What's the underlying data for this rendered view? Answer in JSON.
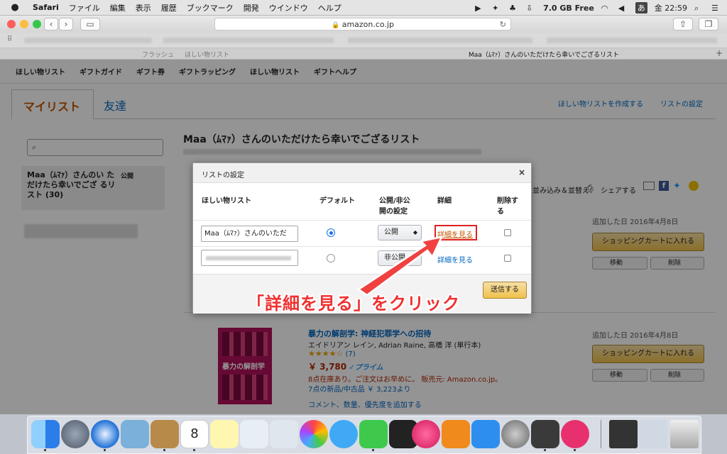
{
  "menubar": {
    "app": "Safari",
    "items": [
      "ファイル",
      "編集",
      "表示",
      "履歴",
      "ブックマーク",
      "開発",
      "ウインドウ",
      "ヘルプ"
    ],
    "memory": "7.0 GB Free",
    "ime": "あ",
    "clock": "金 22:59"
  },
  "browser": {
    "url": "amazon.co.jp",
    "tab_title": "Maa（ﾑﾏｧ）さんのいただけたら幸いでござるリスト",
    "tab_left_text": "フラッシュ",
    "tab_left_text2": "ほしい物リスト"
  },
  "page": {
    "nav": [
      "ほしい物リスト",
      "ギフトガイド",
      "ギフト券",
      "ギフトラッピング",
      "ほしい物リスト",
      "ギフトヘルプ"
    ],
    "tab_mylist": "マイリスト",
    "tab_friends": "友達",
    "link_create": "ほしい物リストを作成する",
    "link_settings": "リストの設定",
    "list_title": "Maa（ﾑﾏｧ）さんのいただけたら幸いでござるリスト",
    "sidebar_list": "Maa（ﾑﾏｧ）さんのい ただけたら幸いでござ るリスト (30)",
    "sidebar_public": "公開",
    "sort_label": "並み込み＆並替え：",
    "share_label": "シェアする",
    "item1": {
      "added": "追加した日 2016年4月8日",
      "cart": "ショッピングカートに入れる",
      "move": "移動",
      "delete": "削除"
    },
    "item2": {
      "added": "追加した日 2016年4月8日",
      "cart": "ショッピングカートに入れる",
      "move": "移動",
      "delete": "削除",
      "title": "暴力の解剖学: 神経犯罪学への招待",
      "author": "エイドリアン レイン, Adrian Raine, 高橋 洋 (単行本)",
      "rating_count": "(7)",
      "price": "￥ 3,780",
      "prime": "✓プライム",
      "stock": "8点在庫あり。ご注文はお早めに。 販売元: Amazon.co.jp。",
      "offers": "7点の新品/中古品 ￥ 3,223より",
      "comment": "コメント、数量、優先度を追加する",
      "cover": "暴力の解剖学",
      "rating": 4.0
    }
  },
  "dialog": {
    "title": "リストの設定",
    "close": "×",
    "col_list": "ほしい物リスト",
    "col_default": "デフォルト",
    "col_public_1": "公開/非公",
    "col_public_2": "開の設定",
    "col_detail": "詳細",
    "col_delete_1": "削除す",
    "col_delete_2": "る",
    "rows": [
      {
        "name": "Maa（ﾑﾏｧ）さんのいただ",
        "public": "公開",
        "detail": "詳細を見る",
        "default": true
      },
      {
        "name": "",
        "public": "非公開",
        "detail": "詳細を見る",
        "default": false
      }
    ],
    "submit": "送信する"
  },
  "annotation": {
    "callout": "「詳細を見る」をクリック",
    "color": "#f03030"
  }
}
